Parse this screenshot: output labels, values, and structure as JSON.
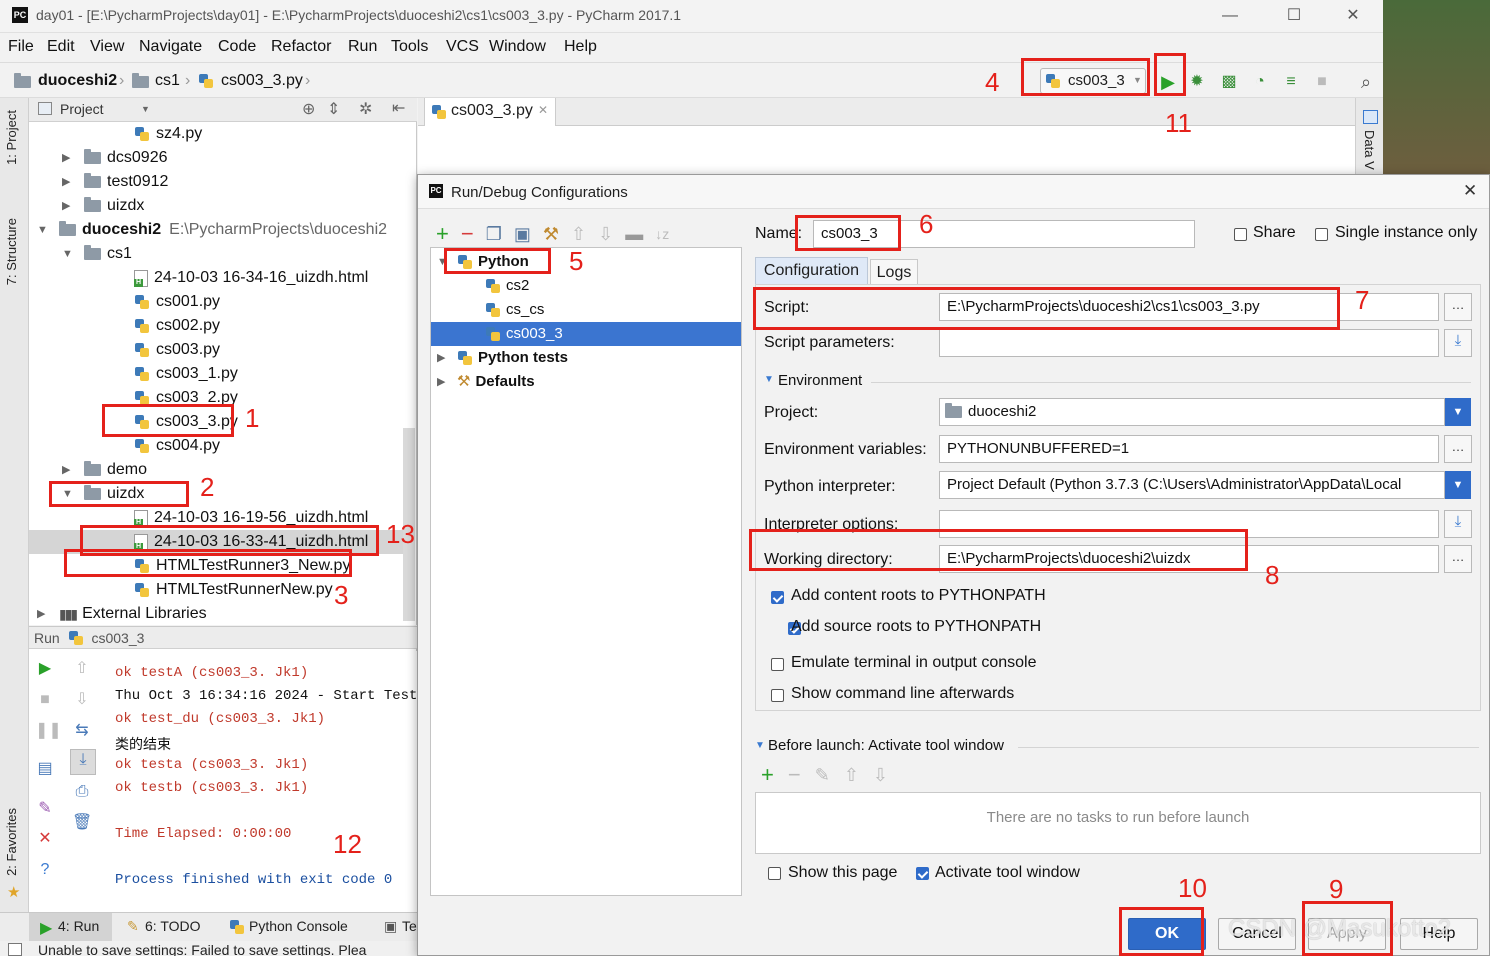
{
  "window": {
    "title": "day01 - [E:\\PycharmProjects\\day01] - E:\\PycharmProjects\\duoceshi2\\cs1\\cs003_3.py - PyCharm 2017.1",
    "logo": "PC",
    "minimize": "—",
    "maximize": "☐",
    "close": "✕"
  },
  "menu": [
    "File",
    "Edit",
    "View",
    "Navigate",
    "Code",
    "Refactor",
    "Run",
    "Tools",
    "VCS",
    "Window",
    "Help"
  ],
  "breadcrumb": [
    "duoceshi2",
    "cs1",
    "cs003_3.py"
  ],
  "toolbar": {
    "run_config": "cs003_3"
  },
  "side_tabs": {
    "project": "1: Project",
    "structure": "7: Structure",
    "favorites": "2: Favorites"
  },
  "project_panel": {
    "header": "Project",
    "rows": [
      {
        "label": "sz4.py",
        "type": "py",
        "indent": 3,
        "arrow": ""
      },
      {
        "label": "dcs0926",
        "type": "folder",
        "indent": 1,
        "arrow": "▶"
      },
      {
        "label": "test0912",
        "type": "folder",
        "indent": 1,
        "arrow": "▶"
      },
      {
        "label": "uizdx",
        "type": "folder",
        "indent": 1,
        "arrow": "▶"
      },
      {
        "label": "duoceshi2",
        "path": "E:\\PycharmProjects\\duoceshi2",
        "type": "folder",
        "indent": 0,
        "arrow": "▼",
        "bold": true
      },
      {
        "label": "cs1",
        "type": "folder",
        "indent": 1,
        "arrow": "▼"
      },
      {
        "label": "24-10-03 16-34-16_uizdh.html",
        "type": "html",
        "indent": 3,
        "arrow": ""
      },
      {
        "label": "cs001.py",
        "type": "py",
        "indent": 3,
        "arrow": ""
      },
      {
        "label": "cs002.py",
        "type": "py",
        "indent": 3,
        "arrow": ""
      },
      {
        "label": "cs003.py",
        "type": "py",
        "indent": 3,
        "arrow": ""
      },
      {
        "label": "cs003_1.py",
        "type": "py",
        "indent": 3,
        "arrow": ""
      },
      {
        "label": "cs003_2.py",
        "type": "py",
        "indent": 3,
        "arrow": ""
      },
      {
        "label": "cs003_3.py",
        "type": "py",
        "indent": 3,
        "arrow": ""
      },
      {
        "label": "cs004.py",
        "type": "py",
        "indent": 3,
        "arrow": ""
      },
      {
        "label": "demo",
        "type": "folder",
        "indent": 1,
        "arrow": "▶"
      },
      {
        "label": "uizdx",
        "type": "folder",
        "indent": 1,
        "arrow": "▼"
      },
      {
        "label": "24-10-03 16-19-56_uizdh.html",
        "type": "html",
        "indent": 3,
        "arrow": ""
      },
      {
        "label": "24-10-03 16-33-41_uizdh.html",
        "type": "html",
        "indent": 3,
        "arrow": "",
        "selected": true
      },
      {
        "label": "HTMLTestRunner3_New.py",
        "type": "py",
        "indent": 3,
        "arrow": ""
      },
      {
        "label": "HTMLTestRunnerNew.py",
        "type": "py",
        "indent": 3,
        "arrow": ""
      },
      {
        "label": "External Libraries",
        "type": "lib",
        "indent": 0,
        "arrow": "▶"
      }
    ]
  },
  "run_panel": {
    "header_prefix": "Run",
    "header_config": "cs003_3",
    "lines": [
      {
        "text": "ok testA (cs003_3. Jk1)",
        "style": "ok"
      },
      {
        "text": "Thu Oct  3 16:34:16 2024 - Start Test:",
        "style": "plain"
      },
      {
        "text": "ok test_du (cs003_3. Jk1)",
        "style": "ok"
      },
      {
        "text": "类的结束",
        "style": "plain"
      },
      {
        "text": "ok testa (cs003_3. Jk1)",
        "style": "ok"
      },
      {
        "text": "ok testb (cs003_3. Jk1)",
        "style": "ok"
      },
      {
        "text": "",
        "style": "plain"
      },
      {
        "text": "Time Elapsed: 0:00:00",
        "style": "ok"
      },
      {
        "text": "",
        "style": "plain"
      },
      {
        "text": "Process finished with exit code 0",
        "style": "blue"
      }
    ]
  },
  "bottom_tabs": [
    "4: Run",
    "6: TODO",
    "Python Console",
    "Te"
  ],
  "status": "Unable to save settings: Failed to save settings. Plea",
  "editor_tab": "cs003_3.py",
  "right_tab": "Data V",
  "dialog": {
    "title": "Run/Debug Configurations",
    "close": "✕",
    "tree": [
      {
        "label": "Python",
        "indent": 0,
        "arrow": "▼",
        "bold": true
      },
      {
        "label": "cs2",
        "indent": 1,
        "arrow": ""
      },
      {
        "label": "cs_cs",
        "indent": 1,
        "arrow": ""
      },
      {
        "label": "cs003_3",
        "indent": 1,
        "arrow": "",
        "selected": true
      },
      {
        "label": "Python tests",
        "indent": 0,
        "arrow": "▶",
        "bold": true
      },
      {
        "label": "Defaults",
        "indent": 0,
        "arrow": "▶",
        "bold": true
      }
    ],
    "name_label": "Name:",
    "name_value": "cs003_3",
    "share_label": "Share",
    "single_instance_label": "Single instance only",
    "tabs": [
      "Configuration",
      "Logs"
    ],
    "script_label": "Script:",
    "script_value": "E:\\PycharmProjects\\duoceshi2\\cs1\\cs003_3.py",
    "params_label": "Script parameters:",
    "environment_label": "Environment",
    "project_label": "Project:",
    "project_value": "duoceshi2",
    "envvars_label": "Environment variables:",
    "envvars_value": "PYTHONUNBUFFERED=1",
    "interp_label": "Python interpreter:",
    "interp_value": "Project Default (Python 3.7.3 (C:\\Users\\Administrator\\AppData\\Local",
    "interp_opts_label": "Interpreter options:",
    "workdir_label": "Working directory:",
    "workdir_value": "E:\\PycharmProjects\\duoceshi2\\uizdx",
    "opt_content_roots": "Add content roots to PYTHONPATH",
    "opt_source_roots": "Add source roots to PYTHONPATH",
    "opt_emulate": "Emulate terminal in output console",
    "opt_cmdline": "Show command line afterwards",
    "before_launch_label": "Before launch: Activate tool window",
    "no_tasks": "There are no tasks to run before launch",
    "show_page": "Show this page",
    "activate_tool": "Activate tool window",
    "buttons": {
      "ok": "OK",
      "cancel": "Cancel",
      "apply": "Apply",
      "help": "Help"
    }
  },
  "annotations": [
    "1",
    "2",
    "3",
    "4",
    "5",
    "6",
    "7",
    "8",
    "9",
    "10",
    "11",
    "12",
    "13"
  ],
  "watermark": "CSDN @Masukotto2",
  "colors": {
    "annotation_red": "#e4211b",
    "selection_blue": "#3b75d0",
    "run_green": "#2aa12a"
  }
}
